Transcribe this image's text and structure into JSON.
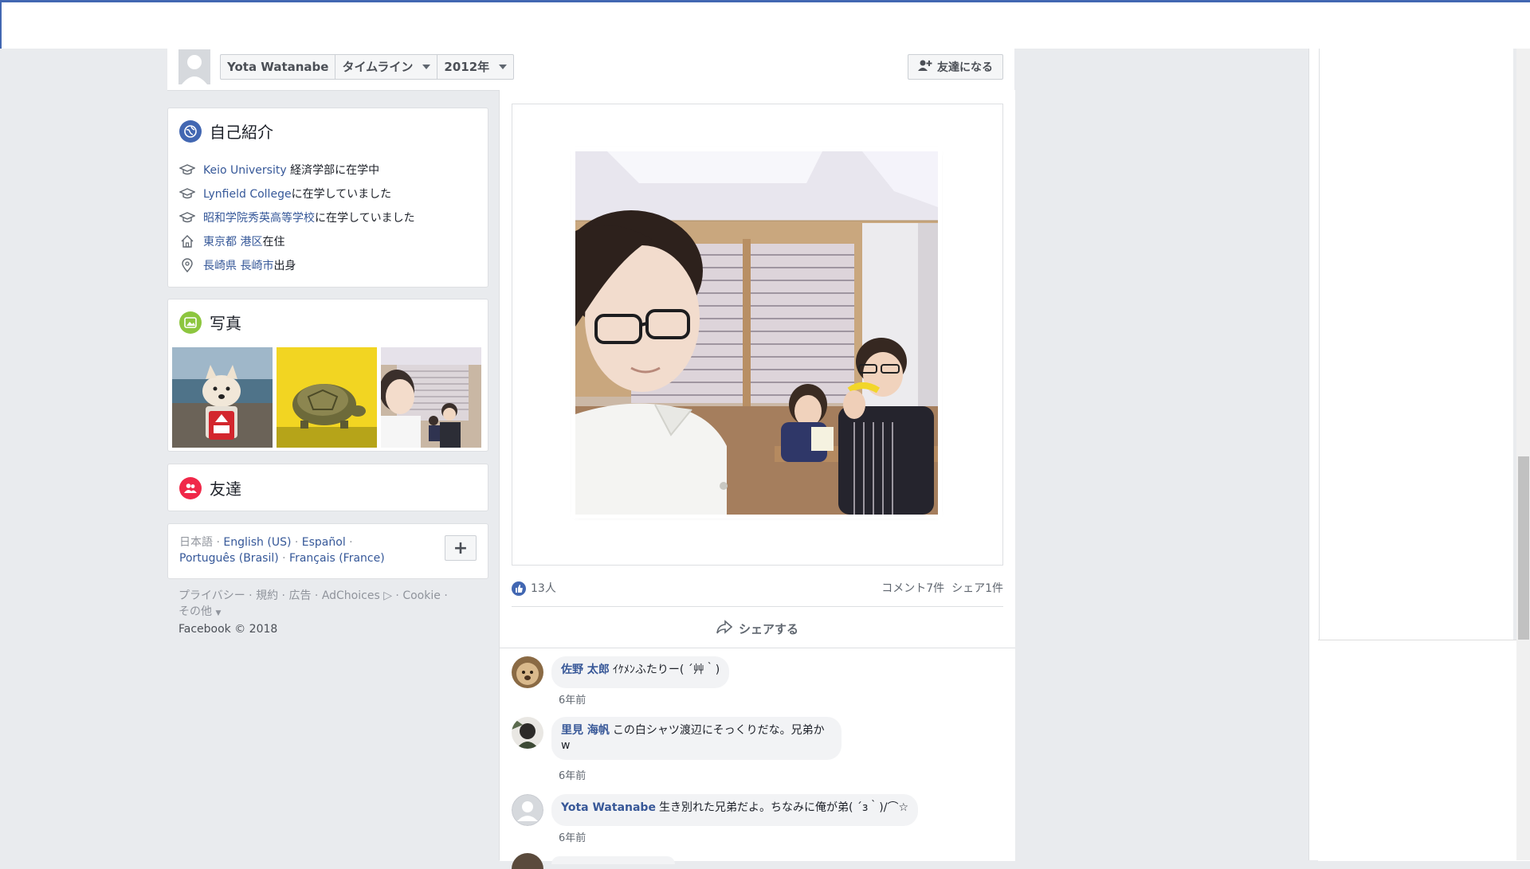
{
  "header": {
    "profile_name": "Yota Watanabe",
    "timeline_label": "タイムライン",
    "year_label": "2012年",
    "add_friend_label": "友達になる"
  },
  "intro": {
    "title": "自己紹介",
    "items": [
      {
        "icon": "graduation-cap-icon",
        "link": "Keio University",
        "text": " 経済学部に在学中"
      },
      {
        "icon": "graduation-cap-icon",
        "link": "Lynfield College",
        "text": "に在学していました"
      },
      {
        "icon": "graduation-cap-icon",
        "link": "昭和学院秀英高等学校",
        "text": "に在学していました"
      },
      {
        "icon": "home-icon",
        "link": "東京都 港区",
        "text": "在住"
      },
      {
        "icon": "location-pin-icon",
        "link": "長崎県 長崎市",
        "text": "出身"
      }
    ]
  },
  "photos": {
    "title": "写真"
  },
  "friends": {
    "title": "友達"
  },
  "languages": {
    "current": "日本語",
    "options": [
      "English (US)",
      "Español",
      "Português (Brasil)",
      "Français (France)"
    ],
    "add_label": "+"
  },
  "footer": {
    "links": [
      "プライバシー",
      "規約",
      "広告",
      "AdChoices",
      "Cookie"
    ],
    "more": "その他",
    "copyright": "Facebook © 2018"
  },
  "post": {
    "likes": "13人",
    "comments_count": "コメント7件",
    "shares_count": "シェア1件",
    "share_label": "シェアする"
  },
  "comments": [
    {
      "author": "佐野 太郎",
      "text": "ｲｹﾒﾝふたりー( ´艸｀)",
      "time": "6年前"
    },
    {
      "author": "里見 海帆",
      "text": "この白シャツ渡辺にそっくりだな。兄弟かw",
      "time": "6年前"
    },
    {
      "author": "Yota Watanabe",
      "text": "生き別れた兄弟だよ。ちなみに俺が弟( ´з｀)/⌒☆",
      "time": "6年前"
    }
  ],
  "colors": {
    "accent": "#4267b2",
    "link": "#365899",
    "intro_icon": "#4267b2",
    "photos_icon": "#8dc63f",
    "friends_icon": "#f02849"
  }
}
